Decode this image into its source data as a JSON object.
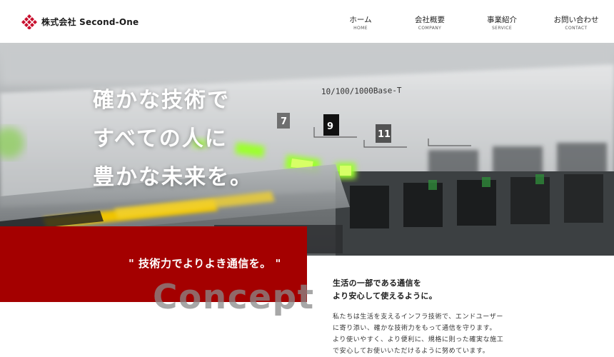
{
  "brand": {
    "name": "株式会社 Second-One",
    "accent": "#c8102e"
  },
  "nav": [
    {
      "jp": "ホーム",
      "en": "HOME"
    },
    {
      "jp": "会社概要",
      "en": "COMPANY"
    },
    {
      "jp": "事業紹介",
      "en": "SERVICE"
    },
    {
      "jp": "お問い合わせ",
      "en": "CONTACT"
    }
  ],
  "hero": {
    "lines": [
      "確かな技術で",
      "すべての人に",
      "豊かな未来を。"
    ],
    "panel_label": "10/100/1000Base-T",
    "port_numbers": [
      "7",
      "9",
      "11"
    ]
  },
  "concept": {
    "quote": "\" 技術力でよりよき通信を。 \"",
    "word": "Concept",
    "band_color": "#a40000"
  },
  "lead": {
    "lines": [
      "生活の一部である通信を",
      "より安心して使えるように。"
    ]
  },
  "body": {
    "lines": [
      "私たちは生活を支えるインフラ技術で、エンドユーザー",
      "に寄り添い、確かな技術力をもって通信を守ります。",
      "より使いやすく、より便利に、規格に則った確実な施工",
      "で安心してお使いいただけるように努めています。"
    ]
  }
}
